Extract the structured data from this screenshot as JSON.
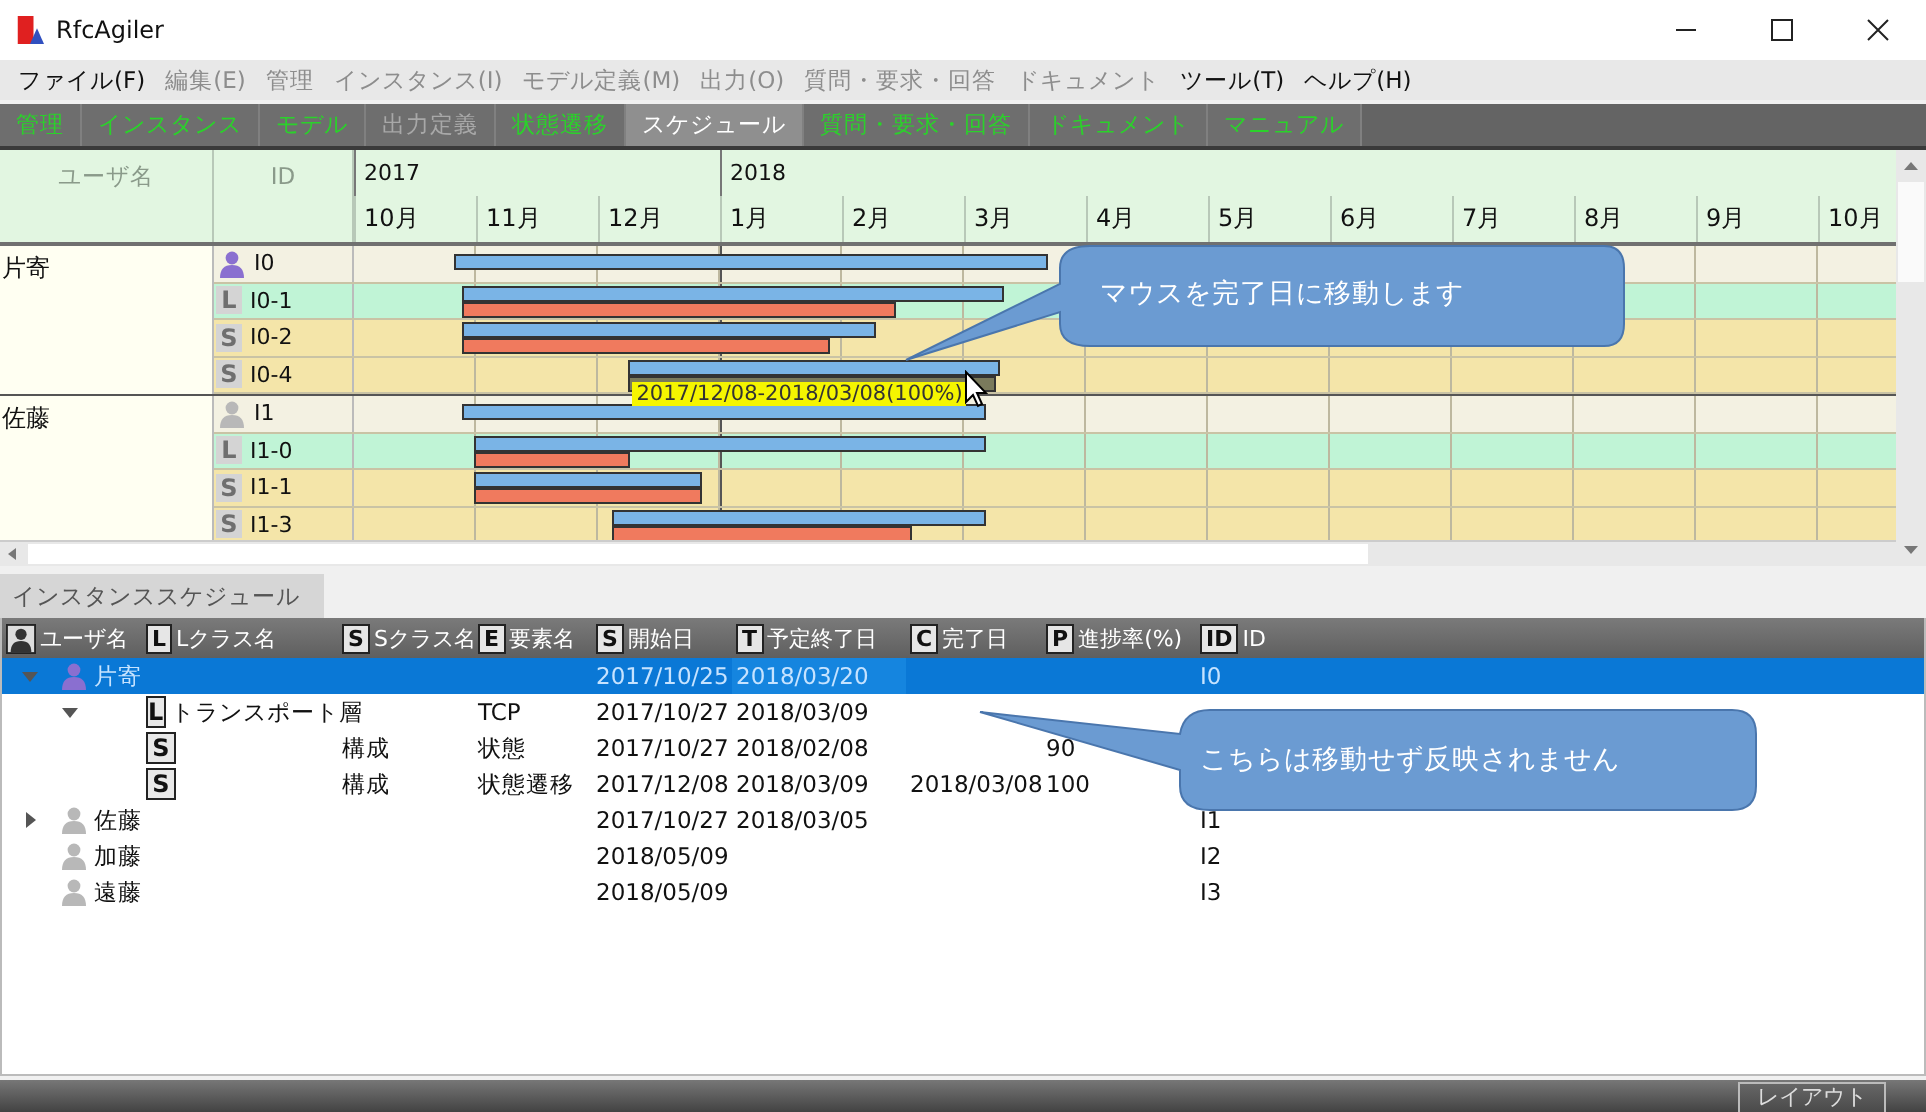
{
  "window": {
    "title": "RfcAgiler"
  },
  "menu": [
    {
      "label": "ファイル(F)",
      "disabled": false
    },
    {
      "label": "編集(E)",
      "disabled": true
    },
    {
      "label": "管理",
      "disabled": true
    },
    {
      "label": "インスタンス(I)",
      "disabled": true
    },
    {
      "label": "モデル定義(M)",
      "disabled": true
    },
    {
      "label": "出力(O)",
      "disabled": true
    },
    {
      "label": "質問・要求・回答",
      "disabled": true
    },
    {
      "label": "ドキュメント",
      "disabled": true
    },
    {
      "label": "ツール(T)",
      "disabled": false
    },
    {
      "label": "ヘルプ(H)",
      "disabled": false
    }
  ],
  "tabs": [
    {
      "label": "管理",
      "selected": false,
      "disabled": false
    },
    {
      "label": "インスタンス",
      "selected": false,
      "disabled": false
    },
    {
      "label": "モデル",
      "selected": false,
      "disabled": false
    },
    {
      "label": "出力定義",
      "selected": false,
      "disabled": true
    },
    {
      "label": "状態遷移",
      "selected": false,
      "disabled": false
    },
    {
      "label": "スケジュール",
      "selected": true,
      "disabled": false
    },
    {
      "label": "質問・要求・回答",
      "selected": false,
      "disabled": false
    },
    {
      "label": "ドキュメント",
      "selected": false,
      "disabled": false
    },
    {
      "label": "マニュアル",
      "selected": false,
      "disabled": false
    }
  ],
  "gantt": {
    "columns": [
      "ユーザ名",
      "ID"
    ],
    "years": [
      {
        "label": "2017",
        "months": [
          "10月",
          "11月",
          "12月"
        ]
      },
      {
        "label": "2018",
        "months": [
          "1月",
          "2月",
          "3月",
          "4月",
          "5月",
          "6月",
          "7月",
          "8月",
          "9月",
          "10月"
        ]
      }
    ],
    "groups": [
      {
        "user": "片寄",
        "rows": [
          {
            "kind": "user",
            "id": "I0",
            "color": "#8a6fd0"
          },
          {
            "kind": "class",
            "badge": "L",
            "id": "I0-1"
          },
          {
            "kind": "class",
            "badge": "S",
            "id": "I0-2"
          },
          {
            "kind": "class",
            "badge": "S",
            "id": "I0-4",
            "tooltip": "2017/12/08-2018/03/08(100%)"
          }
        ]
      },
      {
        "user": "佐藤",
        "rows": [
          {
            "kind": "user",
            "id": "I1",
            "color": "#b8b8b8"
          },
          {
            "kind": "class",
            "badge": "L",
            "id": "I1-0"
          },
          {
            "kind": "class",
            "badge": "S",
            "id": "I1-1"
          },
          {
            "kind": "class",
            "badge": "S",
            "id": "I1-3"
          }
        ]
      }
    ]
  },
  "callouts": [
    {
      "text": "マウスを完了日に移動します"
    },
    {
      "text": "こちらは移動せず反映されません"
    }
  ],
  "panel_tab": {
    "label": "インスタンススケジュール",
    "selected": true
  },
  "table": {
    "columns": [
      {
        "kind": "user",
        "label": "ユーザ名"
      },
      {
        "kind": "badge",
        "badge": "L",
        "label": "Lクラス名"
      },
      {
        "kind": "badge",
        "badge": "S",
        "label": "Sクラス名"
      },
      {
        "kind": "badge",
        "badge": "E",
        "label": "要素名"
      },
      {
        "kind": "badge",
        "badge": "S",
        "label": "開始日"
      },
      {
        "kind": "badge",
        "badge": "T",
        "label": "予定終了日"
      },
      {
        "kind": "badge",
        "badge": "C",
        "label": "完了日"
      },
      {
        "kind": "badge",
        "badge": "P",
        "label": "進捗率(%)"
      },
      {
        "kind": "badge",
        "badge": "ID",
        "label": "ID"
      }
    ],
    "rows": [
      {
        "kind": "user",
        "name": "片寄",
        "color": "#8a6fd0",
        "expanded": true,
        "selected": true,
        "start": "2017/10/25",
        "due": "2018/03/20",
        "id": "I0",
        "children": [
          {
            "kind": "class",
            "badge": "L",
            "name": "トランスポート層",
            "element": "TCP",
            "start": "2017/10/27",
            "due": "2018/03/09",
            "expanded": true,
            "selected": false,
            "children": [
              {
                "kind": "sub",
                "badge": "S",
                "sclass": "構成",
                "element": "状態",
                "start": "2017/10/27",
                "due": "2018/02/08",
                "progress": "90",
                "selected": false
              },
              {
                "kind": "sub",
                "badge": "S",
                "sclass": "構成",
                "element": "状態遷移",
                "start": "2017/12/08",
                "due": "2018/03/09",
                "done": "2018/03/08",
                "progress": "100",
                "selected": false
              }
            ]
          }
        ]
      },
      {
        "kind": "user",
        "name": "佐藤",
        "color": "#b8b8b8",
        "expanded": false,
        "selected": false,
        "start": "2017/10/27",
        "due": "2018/03/05",
        "id": "I1"
      },
      {
        "kind": "user",
        "name": "加藤",
        "color": "#b8b8b8",
        "selected": false,
        "start": "2018/05/09",
        "id": "I2"
      },
      {
        "kind": "user",
        "name": "遠藤",
        "color": "#b8b8b8",
        "selected": false,
        "start": "2018/05/09",
        "id": "I3"
      }
    ]
  },
  "bottom_bar": {
    "button": "レイアウト"
  }
}
